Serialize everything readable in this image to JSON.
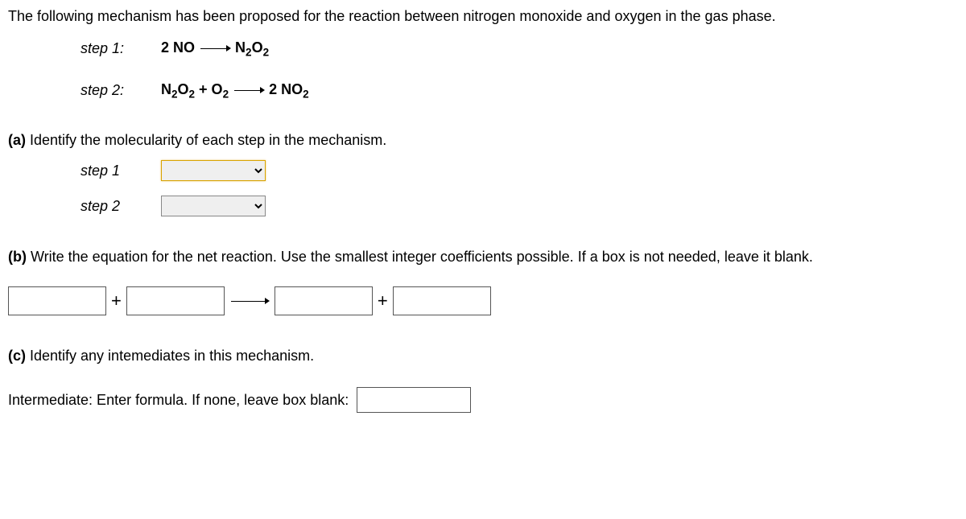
{
  "intro": "The following mechanism has been proposed for the reaction between nitrogen monoxide and oxygen in the gas phase.",
  "steps": {
    "s1": {
      "label": "step 1:",
      "lhs": "2 NO",
      "rhs_plain": "N",
      "rhs_sub1": "2",
      "rhs_mid": "O",
      "rhs_sub2": "2"
    },
    "s2": {
      "label": "step 2:",
      "l_plain1": "N",
      "l_sub1": "2",
      "l_plain2": "O",
      "l_sub2": "2",
      "plus": " + O",
      "l_sub3": "2",
      "r_plain": "2 NO",
      "r_sub": "2"
    }
  },
  "partA": {
    "marker": "(a)",
    "prompt": " Identify the molecularity of each step in the mechanism.",
    "s1": "step 1",
    "s2": "step 2"
  },
  "partB": {
    "marker": "(b)",
    "prompt": " Write the equation for the net reaction. Use the smallest integer coefficients possible. If a box is not needed, leave it blank.",
    "plus1": "+",
    "plus2": "+"
  },
  "partC": {
    "marker": "(c)",
    "prompt": " Identify any intemediates in this mechanism.",
    "intLabel": "Intermediate: Enter formula. If none, leave box blank:"
  }
}
